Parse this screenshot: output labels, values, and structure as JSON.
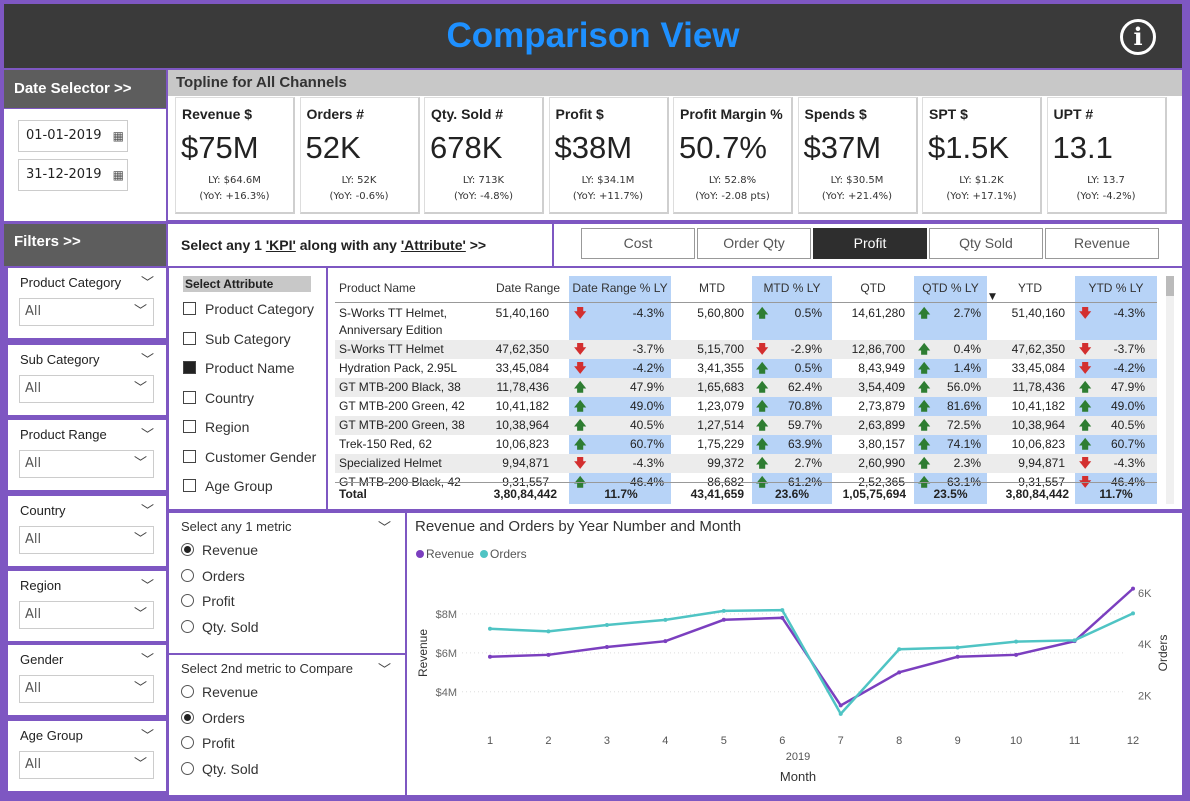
{
  "header": {
    "title": "Comparison View",
    "info_icon": "info-icon"
  },
  "date_selector": {
    "label": "Date Selector >>",
    "start": "01-01-2019",
    "end": "31-12-2019",
    "icon": "calendar-icon"
  },
  "filters": {
    "label": "Filters >>",
    "slicers": [
      {
        "label": "Product Category",
        "value": "All"
      },
      {
        "label": "Sub Category",
        "value": "All"
      },
      {
        "label": "Product Range",
        "value": "All"
      },
      {
        "label": "Country",
        "value": "All"
      },
      {
        "label": "Region",
        "value": "All"
      },
      {
        "label": "Gender",
        "value": "All"
      },
      {
        "label": "Age Group",
        "value": "All"
      }
    ]
  },
  "topline": {
    "title": "Topline for All Channels",
    "kpis": [
      {
        "title": "Revenue $",
        "value": "$75M",
        "ly": "LY: $64.6M",
        "yoy": "(YoY: +16.3%)"
      },
      {
        "title": "Orders #",
        "value": "52K",
        "ly": "LY: 52K",
        "yoy": "(YoY: -0.6%)"
      },
      {
        "title": "Qty. Sold #",
        "value": "678K",
        "ly": "LY: 713K",
        "yoy": "(YoY: -4.8%)"
      },
      {
        "title": "Profit $",
        "value": "$38M",
        "ly": "LY: $34.1M",
        "yoy": "(YoY: +11.7%)"
      },
      {
        "title": "Profit Margin %",
        "value": "50.7%",
        "ly": "LY: 52.8%",
        "yoy": "(YoY: -2.08 pts)"
      },
      {
        "title": "Spends $",
        "value": "$37M",
        "ly": "LY: $30.5M",
        "yoy": "(YoY: +21.4%)"
      },
      {
        "title": "SPT $",
        "value": "$1.5K",
        "ly": "LY: $1.2K",
        "yoy": "(YoY: +17.1%)"
      },
      {
        "title": "UPT #",
        "value": "13.1",
        "ly": "LY: 13.7",
        "yoy": "(YoY: -4.2%)"
      }
    ]
  },
  "kpi_selector": {
    "prefix": "Select any 1 ",
    "kpi_word": "'KPI'",
    "middle": " along with any ",
    "attr_word": "'Attribute'",
    "suffix": " >>",
    "tabs": [
      "Cost",
      "Order Qty",
      "Profit",
      "Qty Sold",
      "Revenue"
    ],
    "active": "Profit"
  },
  "attributes": {
    "title": "Select Attribute",
    "items": [
      {
        "label": "Product Category",
        "checked": false
      },
      {
        "label": "Sub Category",
        "checked": false
      },
      {
        "label": "Product Name",
        "checked": true
      },
      {
        "label": "Country",
        "checked": false
      },
      {
        "label": "Region",
        "checked": false
      },
      {
        "label": "Customer Gender",
        "checked": false
      },
      {
        "label": "Age Group",
        "checked": false
      }
    ]
  },
  "table": {
    "headers": [
      "Product Name",
      "Date Range",
      "Date Range % LY",
      "MTD",
      "MTD % LY",
      "QTD",
      "QTD % LY",
      "YTD",
      "YTD % LY"
    ],
    "rows": [
      {
        "name": "S-Works TT Helmet,",
        "name2": "Anniversary Edition",
        "dr": "51,40,160",
        "drp": "-4.3%",
        "dra": "down",
        "mtd": "5,60,800",
        "mtdp": "0.5%",
        "mtda": "up",
        "qtd": "14,61,280",
        "qtdp": "2.7%",
        "qtda": "up",
        "ytd": "51,40,160",
        "ytdp": "-4.3%",
        "ytda": "down"
      },
      {
        "name": "S-Works TT Helmet",
        "dr": "47,62,350",
        "drp": "-3.7%",
        "dra": "down",
        "mtd": "5,15,700",
        "mtdp": "-2.9%",
        "mtda": "down",
        "qtd": "12,86,700",
        "qtdp": "0.4%",
        "qtda": "up",
        "ytd": "47,62,350",
        "ytdp": "-3.7%",
        "ytda": "down"
      },
      {
        "name": "Hydration Pack, 2.95L",
        "dr": "33,45,084",
        "drp": "-4.2%",
        "dra": "down",
        "mtd": "3,41,355",
        "mtdp": "0.5%",
        "mtda": "up",
        "qtd": "8,43,949",
        "qtdp": "1.4%",
        "qtda": "up",
        "ytd": "33,45,084",
        "ytdp": "-4.2%",
        "ytda": "down"
      },
      {
        "name": "GT MTB-200 Black, 38",
        "dr": "11,78,436",
        "drp": "47.9%",
        "dra": "up",
        "mtd": "1,65,683",
        "mtdp": "62.4%",
        "mtda": "up",
        "qtd": "3,54,409",
        "qtdp": "56.0%",
        "qtda": "up",
        "ytd": "11,78,436",
        "ytdp": "47.9%",
        "ytda": "up"
      },
      {
        "name": "GT MTB-200 Green, 42",
        "dr": "10,41,182",
        "drp": "49.0%",
        "dra": "up",
        "mtd": "1,23,079",
        "mtdp": "70.8%",
        "mtda": "up",
        "qtd": "2,73,879",
        "qtdp": "81.6%",
        "qtda": "up",
        "ytd": "10,41,182",
        "ytdp": "49.0%",
        "ytda": "up"
      },
      {
        "name": "GT MTB-200 Green, 38",
        "dr": "10,38,964",
        "drp": "40.5%",
        "dra": "up",
        "mtd": "1,27,514",
        "mtdp": "59.7%",
        "mtda": "up",
        "qtd": "2,63,899",
        "qtdp": "72.5%",
        "qtda": "up",
        "ytd": "10,38,964",
        "ytdp": "40.5%",
        "ytda": "up"
      },
      {
        "name": "Trek-150 Red, 62",
        "dr": "10,06,823",
        "drp": "60.7%",
        "dra": "up",
        "mtd": "1,75,229",
        "mtdp": "63.9%",
        "mtda": "up",
        "qtd": "3,80,157",
        "qtdp": "74.1%",
        "qtda": "up",
        "ytd": "10,06,823",
        "ytdp": "60.7%",
        "ytda": "up"
      },
      {
        "name": "Specialized Helmet",
        "dr": "9,94,871",
        "drp": "-4.3%",
        "dra": "down",
        "mtd": "99,372",
        "mtdp": "2.7%",
        "mtda": "up",
        "qtd": "2,60,990",
        "qtdp": "2.3%",
        "qtda": "up",
        "ytd": "9,94,871",
        "ytdp": "-4.3%",
        "ytda": "down"
      },
      {
        "name": "GT MTB-200 Black, 42",
        "dr": "9,31,557",
        "drp": "46.4%",
        "dra": "up",
        "mtd": "86,682",
        "mtdp": "61.2%",
        "mtda": "up",
        "qtd": "2,52,365",
        "qtdp": "63.1%",
        "qtda": "up",
        "ytd": "9,31,557",
        "ytdp": "46.4%",
        "ytda": "down"
      }
    ],
    "total": {
      "label": "Total",
      "dr": "3,80,84,442",
      "drp": "11.7%",
      "mtd": "43,41,659",
      "mtdp": "23.6%",
      "qtd": "1,05,75,694",
      "qtdp": "23.5%",
      "ytd": "3,80,84,442",
      "ytdp": "11.7%"
    }
  },
  "metric1": {
    "title": "Select any 1 metric",
    "options": [
      "Revenue",
      "Orders",
      "Profit",
      "Qty. Sold"
    ],
    "selected": "Revenue"
  },
  "metric2": {
    "title": "Select 2nd metric to Compare",
    "options": [
      "Revenue",
      "Orders",
      "Profit",
      "Qty. Sold"
    ],
    "selected": "Orders"
  },
  "chart_data": {
    "type": "line",
    "title": "Revenue and Orders by Year Number and Month",
    "xlabel": "Month",
    "xgroup": "2019",
    "ylabel": "Revenue",
    "y2label": "Orders",
    "categories": [
      1,
      2,
      3,
      4,
      5,
      6,
      7,
      8,
      9,
      10,
      11,
      12
    ],
    "series": [
      {
        "name": "Revenue",
        "axis": "left",
        "color": "#7b3fbf",
        "values": [
          5.8,
          5.9,
          6.3,
          6.6,
          7.7,
          7.8,
          3.3,
          5.0,
          5.8,
          5.9,
          6.6,
          9.3
        ]
      },
      {
        "name": "Orders",
        "axis": "right",
        "color": "#4fc4c4",
        "values": [
          4.6,
          4.5,
          4.75,
          4.95,
          5.3,
          5.33,
          1.28,
          3.8,
          3.87,
          4.1,
          4.15,
          5.2
        ]
      }
    ],
    "yticks": [
      "$4M",
      "$6M",
      "$8M"
    ],
    "y2ticks": [
      "2K",
      "4K",
      "6K"
    ],
    "ylim": [
      2.5,
      10
    ],
    "y2lim": [
      1.0,
      6.7
    ],
    "legend": "top-left",
    "grid": true
  }
}
